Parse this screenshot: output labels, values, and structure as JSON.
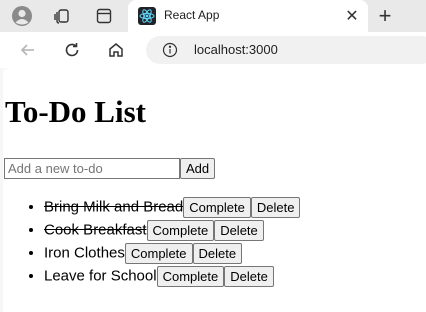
{
  "browser": {
    "tab": {
      "title": "React App",
      "close_glyph": "✕"
    },
    "new_tab_glyph": "+",
    "address": {
      "url": "localhost:3000"
    },
    "icons": [
      "profile-icon",
      "workspaces-icon",
      "tab-actions-icon",
      "react-favicon-icon",
      "back-arrow-icon",
      "reload-icon",
      "home-icon",
      "site-info-icon"
    ]
  },
  "page": {
    "title": "To-Do List",
    "input": {
      "placeholder": "Add a new to-do",
      "value": ""
    },
    "add_label": "Add",
    "todos": [
      {
        "text": "Bring Milk and Bread",
        "completed": true
      },
      {
        "text": "Cook Breakfast",
        "completed": true
      },
      {
        "text": "Iron Clothes",
        "completed": false
      },
      {
        "text": "Leave for School",
        "completed": false
      }
    ],
    "complete_label": "Complete",
    "delete_label": "Delete"
  },
  "colors": {
    "tab_strip_bg": "#e9e9e9",
    "active_tab_bg": "#ffffff",
    "omnibox_bg": "#f1f1f1",
    "react_blue": "#61dafb",
    "button_bg": "#efefef"
  }
}
